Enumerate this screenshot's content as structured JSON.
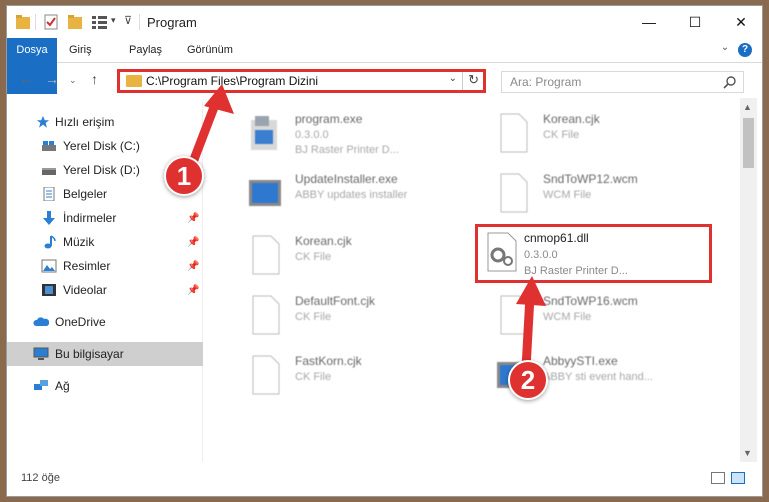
{
  "window": {
    "title": "Program",
    "minimize": "—",
    "maximize": "☐",
    "close": "✕"
  },
  "ribbon": {
    "tabs": [
      "Dosya",
      "Giriş",
      "Paylaş",
      "Görünüm"
    ],
    "help": "?"
  },
  "navigation": {
    "address": "C:\\Program Files\\Program Dizini",
    "search_placeholder": "Ara: Program"
  },
  "sidebar": {
    "items": [
      {
        "label": "Hızlı erişim",
        "icon": "star-icon"
      },
      {
        "label": "Yerel Disk (C:)",
        "icon": "drive-icon"
      },
      {
        "label": "Yerel Disk (D:)",
        "icon": "drive-icon"
      },
      {
        "label": "Belgeler",
        "icon": "documents-icon"
      },
      {
        "label": "İndirmeler",
        "icon": "download-icon"
      },
      {
        "label": "Müzik",
        "icon": "music-icon"
      },
      {
        "label": "Resimler",
        "icon": "pictures-icon"
      },
      {
        "label": "Videolar",
        "icon": "video-icon"
      },
      {
        "label": "OneDrive",
        "icon": "cloud-icon"
      },
      {
        "label": "Bu bilgisayar",
        "icon": "computer-icon"
      },
      {
        "label": "Ağ",
        "icon": "network-icon"
      }
    ]
  },
  "files": [
    {
      "name": "program.exe",
      "line1": "0.3.0.0",
      "line2": "BJ Raster Printer D..."
    },
    {
      "name": "Korean.cjk",
      "line1": "CK File",
      "line2": ""
    },
    {
      "name": "UpdateInstaller.exe",
      "line1": "ABBY updates installer",
      "line2": ""
    },
    {
      "name": "SndToWP12.wcm",
      "line1": "WCM File",
      "line2": ""
    },
    {
      "name": "Korean.cjk",
      "line1": "CK File",
      "line2": ""
    },
    {
      "name": "DefaultFont.cjk",
      "line1": "CK File",
      "line2": ""
    },
    {
      "name": "SndToWP16.wcm",
      "line1": "WCM File",
      "line2": ""
    },
    {
      "name": "FastKorn.cjk",
      "line1": "CK File",
      "line2": ""
    },
    {
      "name": "AbbyySTI.exe",
      "line1": "ABBY sti event hand...",
      "line2": ""
    }
  ],
  "highlighted_file": {
    "name": "cnmop61.dll",
    "version": "0.3.0.0",
    "description": "BJ Raster Printer D..."
  },
  "status": {
    "count": "112 öğe"
  },
  "annotations": {
    "step1": "1",
    "step2": "2"
  },
  "colors": {
    "accent": "#1a6fc4",
    "annotation": "#e03131",
    "folder": "#e8b341"
  }
}
